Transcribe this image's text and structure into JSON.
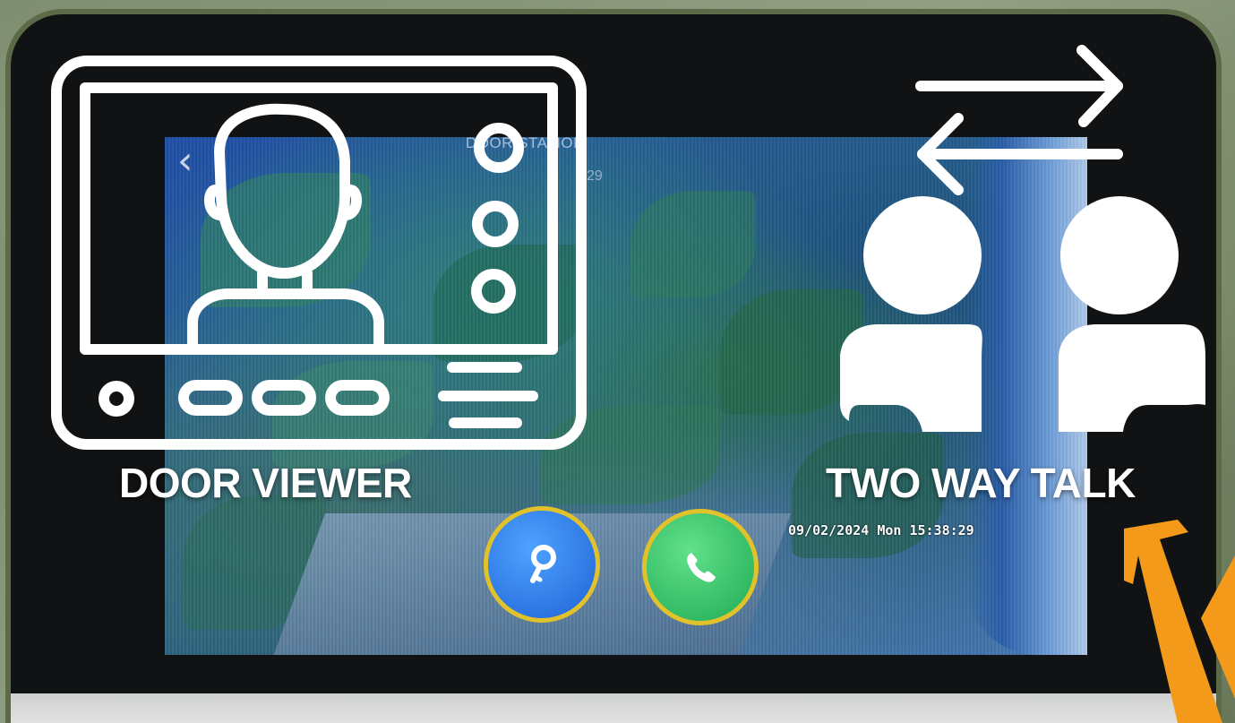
{
  "screen": {
    "station_label": "DOOR STATION",
    "station_sub": "29",
    "timestamp": "09/02/2024 Mon 15:38:29"
  },
  "controls": {
    "unlock_icon": "key-icon",
    "call_icon": "phone-icon",
    "unlock_color": "#1f63d6",
    "call_color": "#1fab55",
    "ring_color": "#e2c22a"
  },
  "features": {
    "door_viewer": "DOOR VIEWER",
    "two_way_talk": "TWO WAY TALK"
  },
  "accent": {
    "arrow_color": "#f39a1a"
  }
}
